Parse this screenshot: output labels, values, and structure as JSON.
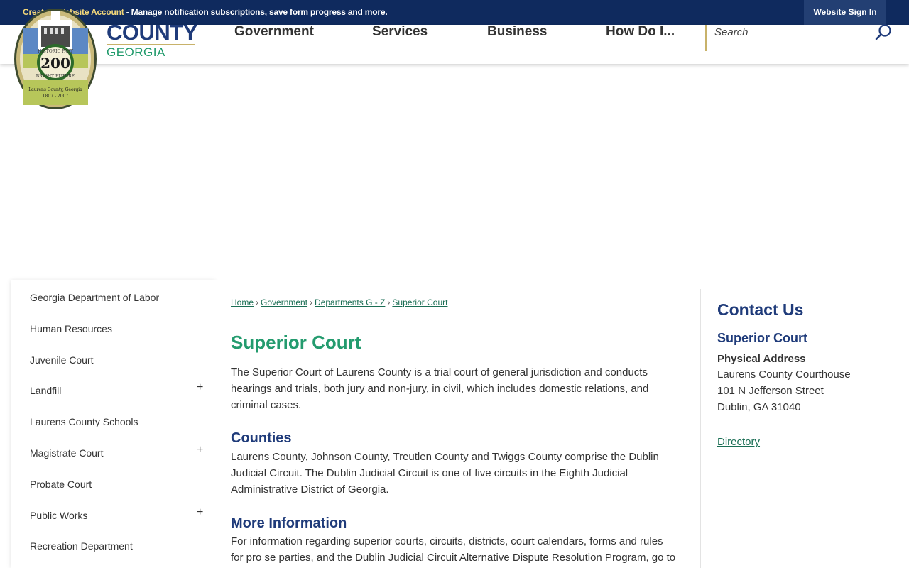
{
  "topbar": {
    "create_account": "Create a Website Account",
    "message": " - Manage notification subscriptions, save form progress and more.",
    "sign_in": "Website Sign In",
    "colors": {
      "bar": "#0f2a5e",
      "accent": "#f1d67a"
    }
  },
  "header": {
    "county": "COUNTY",
    "state": "GEORGIA",
    "logo": {
      "ring_top": "HISTORIC PAST",
      "ring_bottom": "BRIGHT FUTURE",
      "number": "200",
      "caption": "Laurens County, Georgia",
      "years": "1807 - 2007"
    },
    "nav": [
      "Government",
      "Services",
      "Business",
      "How Do I..."
    ],
    "search": {
      "placeholder": "Search",
      "icon": "search-icon"
    },
    "colors": {
      "primary": "#1f3b7a",
      "green": "#1e9a6a",
      "gold": "#c8b26a"
    }
  },
  "sidebar": {
    "items": [
      {
        "label": "Georgia Department of Labor",
        "toggle": ""
      },
      {
        "label": "Human Resources",
        "toggle": ""
      },
      {
        "label": "Juvenile Court",
        "toggle": ""
      },
      {
        "label": "Landfill",
        "toggle": "+"
      },
      {
        "label": "Laurens County Schools",
        "toggle": ""
      },
      {
        "label": "Magistrate Court",
        "toggle": "+"
      },
      {
        "label": "Probate Court",
        "toggle": ""
      },
      {
        "label": "Public Works",
        "toggle": "+"
      },
      {
        "label": "Recreation Department",
        "toggle": ""
      }
    ]
  },
  "breadcrumb": {
    "items": [
      "Home",
      "Government",
      "Departments G - Z",
      "Superior Court"
    ],
    "separator": "›"
  },
  "main": {
    "title": "Superior Court",
    "intro_lines": [
      "The Superior Court of Laurens County is a trial court of general jurisdiction and conducts",
      "hearings and trials, both jury and non-jury, in civil, which includes domestic relations, and",
      "criminal cases."
    ],
    "counties_heading": "Counties",
    "counties_lines": [
      "Laurens County, Johnson County, Treutlen County and Twiggs County comprise the Dublin",
      "Judicial Circuit. The Dublin Judicial Circuit is one of five circuits in the Eighth Judicial",
      "Administrative District of Georgia."
    ],
    "more_heading": "More Information",
    "more_lines": [
      "For information regarding superior courts, circuits, districts, court calendars, forms and rules",
      "for pro se parties, and the Dublin Judicial Circuit Alternative Dispute Resolution Program, go to"
    ]
  },
  "contact": {
    "heading": "Contact Us",
    "name": "Superior Court",
    "address_label": "Physical Address",
    "address_lines": [
      "Laurens County Courthouse",
      "101 N Jefferson Street",
      "Dublin, GA 31040"
    ],
    "directory": "Directory"
  }
}
